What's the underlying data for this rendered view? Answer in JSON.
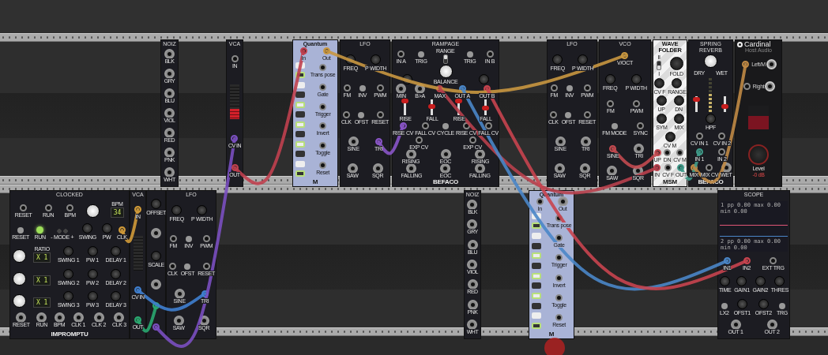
{
  "rows": [
    {
      "modules": [
        {
          "title": "NOIZ",
          "kind": "dark",
          "sections": [
            [
              {
                "kind": "out",
                "label": "BLK"
              }
            ],
            [
              {
                "kind": "out",
                "label": "GRY"
              }
            ],
            [
              {
                "kind": "out",
                "label": "BLU"
              }
            ],
            [
              {
                "kind": "out",
                "label": "VIOL"
              }
            ],
            [
              {
                "kind": "out",
                "label": "RED"
              }
            ],
            [
              {
                "kind": "out",
                "label": "PNK"
              }
            ],
            [
              {
                "kind": "out",
                "label": "WHT"
              }
            ]
          ]
        },
        {
          "title": "VCA",
          "kind": "dark",
          "sections": [
            [
              {
                "kind": "jack",
                "label": "IN"
              }
            ],
            [
              {
                "kind": "meter",
                "level": 0.3
              }
            ],
            [
              {
                "kind": "jack",
                "label": "CV IN",
                "color": "#7a4fc0"
              }
            ],
            [
              {
                "kind": "out",
                "label": "OUT",
                "color": "#c0404f"
              }
            ]
          ]
        },
        {
          "title": "Quantum",
          "kind": "quantum",
          "brand": "M",
          "keys": [
            {
              "on": false
            },
            {
              "on": true
            },
            {
              "on": false
            },
            {
              "on": false
            },
            {
              "on": true
            },
            {
              "on": false
            },
            {
              "on": true
            },
            {
              "on": false
            },
            {
              "on": true
            },
            {
              "on": false
            },
            {
              "on": false
            },
            {
              "on": true
            }
          ],
          "sections": [
            [
              {
                "kind": "jack",
                "label": "In",
                "color": "#c0404f"
              },
              {
                "kind": "out",
                "label": "Out",
                "color": "#c99740"
              }
            ],
            [
              {
                "kind": "jack",
                "label": "Trans pose"
              }
            ],
            [
              {
                "kind": "jack",
                "label": "Gate"
              }
            ],
            [
              {
                "kind": "jack",
                "label": "Trigger"
              }
            ],
            [
              {
                "kind": "jack",
                "label": "Invert"
              }
            ],
            [
              {
                "kind": "jack",
                "label": "Toggle"
              }
            ],
            [
              {
                "kind": "jack",
                "label": "Reset"
              }
            ]
          ]
        },
        {
          "title": "LFO",
          "kind": "dark",
          "sections": [
            [
              {
                "kind": "knob",
                "label": "FREQ"
              },
              {
                "kind": "knob",
                "label": "P WIDTH"
              }
            ],
            [
              {
                "kind": "jack",
                "label": "FM"
              },
              {
                "kind": "button",
                "label": "INV"
              },
              {
                "kind": "jack",
                "label": "PWM"
              }
            ],
            [
              {
                "kind": "jack",
                "label": "CLK"
              },
              {
                "kind": "button",
                "label": "OFST"
              },
              {
                "kind": "jack",
                "label": "RESET"
              }
            ],
            [
              {
                "kind": "out",
                "label": "SINE"
              },
              {
                "kind": "out",
                "label": "TRI",
                "color": "#8a55c8"
              }
            ],
            [
              {
                "kind": "out",
                "label": "SAW"
              },
              {
                "kind": "out",
                "label": "SQR"
              }
            ]
          ]
        },
        {
          "title": "RAMPAGE",
          "kind": "dark",
          "brand": "BEFACO",
          "sections": [
            [
              {
                "kind": "jack",
                "label": "IN A"
              },
              {
                "kind": "button",
                "label": "TRIG"
              },
              {
                "kind": "toggle",
                "label": "RANGE",
                "on": true
              },
              {
                "kind": "button",
                "label": "TRIG"
              },
              {
                "kind": "jack",
                "label": "IN B"
              }
            ],
            [
              {
                "kind": "knob"
              },
              {
                "kind": "bigknob",
                "label": "BALANCE"
              },
              {
                "kind": "knob"
              }
            ],
            [
              {
                "kind": "out",
                "label": "MIN"
              },
              {
                "kind": "out",
                "label": "B>A"
              },
              {
                "kind": "out",
                "label": "MAX",
                "color": "#b8404c"
              },
              {
                "kind": "out",
                "label": "OUT A",
                "color": "#4a86c8"
              },
              {
                "kind": "out",
                "label": "OUT B",
                "color": "#c8444f"
              }
            ],
            [
              {
                "kind": "slider",
                "label": "RISE",
                "level": 0.85
              },
              {
                "kind": "slider",
                "label": "FALL",
                "level": 0.45
              },
              {
                "kind": "slider",
                "label": "RISE",
                "level": 0.85
              },
              {
                "kind": "slider",
                "label": "FALL",
                "level": 0.3
              }
            ],
            [
              {
                "kind": "jack",
                "label": "RISE CV",
                "color": "#8a55c8"
              },
              {
                "kind": "jack",
                "label": "FALL CV"
              },
              {
                "kind": "button",
                "label": "CYCLE"
              },
              {
                "kind": "jack",
                "label": "RISE CV"
              },
              {
                "kind": "jack",
                "label": "FALL CV"
              }
            ],
            [
              {
                "kind": "jack",
                "label": "EXP CV"
              },
              {
                "kind": "jack",
                "label": "EXP CV"
              }
            ],
            [
              {
                "kind": "out",
                "label": "RISING"
              },
              {
                "kind": "out",
                "label": "EOC"
              },
              {
                "kind": "out",
                "label": "RISING"
              }
            ],
            [
              {
                "kind": "out",
                "label": "FALLING"
              },
              {
                "kind": "out",
                "label": "EOC"
              },
              {
                "kind": "out",
                "label": "FALLING"
              }
            ]
          ]
        },
        {
          "title": "LFO",
          "kind": "dark",
          "sections": [
            [
              {
                "kind": "knob",
                "label": "FREQ"
              },
              {
                "kind": "knob",
                "label": "P WIDTH"
              }
            ],
            [
              {
                "kind": "jack",
                "label": "FM"
              },
              {
                "kind": "button",
                "label": "INV"
              },
              {
                "kind": "jack",
                "label": "PWM"
              }
            ],
            [
              {
                "kind": "jack",
                "label": "CLK"
              },
              {
                "kind": "button",
                "label": "OFST"
              },
              {
                "kind": "jack",
                "label": "RESET"
              }
            ],
            [
              {
                "kind": "out",
                "label": "SINE"
              },
              {
                "kind": "out",
                "label": "TRI"
              }
            ],
            [
              {
                "kind": "out",
                "label": "SAW"
              },
              {
                "kind": "out",
                "label": "SQR"
              }
            ]
          ]
        },
        {
          "title": "VCO",
          "kind": "dark",
          "sections": [
            [
              {
                "kind": "jack",
                "label": "V/OCT",
                "color": "#c99740"
              }
            ],
            [
              {
                "kind": "knob",
                "label": "FREQ"
              },
              {
                "kind": "knob",
                "label": "P WIDTH"
              }
            ],
            [
              {
                "kind": "jack",
                "label": "FM"
              },
              {
                "kind": "jack",
                "label": "PWM"
              }
            ],
            [
              {
                "kind": "button",
                "label": "FM MODE"
              },
              {
                "kind": "jack",
                "label": "SYNC"
              }
            ],
            [
              {
                "kind": "out",
                "label": "SINE",
                "color": "#c24a50"
              },
              {
                "kind": "out",
                "label": "TRI"
              }
            ],
            [
              {
                "kind": "out",
                "label": "SAW"
              },
              {
                "kind": "out",
                "label": "SQR"
              }
            ]
          ]
        },
        {
          "title": "WAVE FOLDER",
          "kind": "folder",
          "brand": "MSM",
          "sections": [
            [
              {
                "kind": "toggle",
                "label": "II",
                "label2": "I",
                "on": false
              },
              {
                "kind": "bigknob",
                "label": "FOLD"
              }
            ],
            [
              {
                "kind": "knob",
                "label": "CV F"
              },
              {
                "kind": "knob",
                "label": "RANGE"
              }
            ],
            [
              {
                "kind": "knob",
                "label": "UP"
              },
              {
                "kind": "knob",
                "label": "DN"
              }
            ],
            [
              {
                "kind": "knob",
                "label": "SYM"
              },
              {
                "kind": "knob",
                "label": "MIX"
              }
            ],
            [
              {
                "kind": "knob",
                "label": "CV M"
              }
            ],
            [
              {
                "kind": "jack",
                "label": "UP",
                "color": "#c24a50"
              },
              {
                "kind": "jack",
                "label": "DN"
              },
              {
                "kind": "jack",
                "label": "CV M"
              }
            ],
            [
              {
                "kind": "jack",
                "label": "IN",
                "color": "#b8404c"
              },
              {
                "kind": "jack",
                "label": "CV F"
              },
              {
                "kind": "out",
                "label": "OUT",
                "color": "#3f9a8a"
              }
            ]
          ]
        },
        {
          "title": "SPRING REVERB",
          "kind": "dark",
          "brand": "BEFACO",
          "sections": [
            [
              {
                "kind": "bigknob"
              }
            ],
            [
              {
                "kind": "text",
                "label": "DRY"
              },
              {
                "kind": "text",
                "label": "WET"
              }
            ],
            [
              {
                "kind": "slider",
                "level": 0.75
              },
              {
                "kind": "vu"
              },
              {
                "kind": "slider",
                "level": 0.2
              }
            ],
            [
              {
                "kind": "knob",
                "label": "HPF"
              }
            ],
            [
              {
                "kind": "jack",
                "label": "CV IN 1"
              },
              {
                "kind": "jack",
                "label": "CV IN 2"
              }
            ],
            [
              {
                "kind": "jack",
                "label": "IN 1",
                "color": "#3f9a8a"
              },
              {
                "kind": "jack",
                "label": "IN 2"
              }
            ],
            [
              {
                "kind": "jack",
                "label": "MIX",
                "color": "#c08a45"
              },
              {
                "kind": "jack",
                "label": "MIX CV"
              },
              {
                "kind": "out",
                "label": "WET"
              }
            ]
          ]
        },
        {
          "title": "Cardinal",
          "subtitle": "Host Audio",
          "kind": "cardinal",
          "sections": [
            [
              {
                "kind": "jackpair",
                "label": "Left/M",
                "color": "#c08a45"
              }
            ],
            [
              {
                "kind": "jackpair",
                "label": "Right"
              }
            ],
            [
              {
                "kind": "meter",
                "level": 0.55
              }
            ],
            [
              {
                "kind": "bigknob",
                "label": "Level",
                "reading": "-0 dB"
              }
            ]
          ]
        }
      ]
    },
    {
      "modules": [
        {
          "title": "CLOCKED",
          "kind": "dark",
          "brand": "IMPROMPTU",
          "sections": [
            [
              {
                "kind": "jack",
                "label": "RESET"
              },
              {
                "kind": "jack",
                "label": "RUN"
              },
              {
                "kind": "jack",
                "label": "BPM"
              },
              {
                "kind": "bigknob"
              },
              {
                "kind": "display",
                "label": "BPM",
                "value": "34"
              }
            ],
            [
              {
                "kind": "button",
                "label": "RESET"
              },
              {
                "kind": "led",
                "label": "RUN",
                "on": true
              },
              {
                "kind": "buttons",
                "label": "- MODE +"
              },
              {
                "kind": "knob",
                "label": "SWING"
              },
              {
                "kind": "knob",
                "label": "PW"
              },
              {
                "kind": "jack",
                "label": "CLK",
                "color": "#d09a38"
              }
            ],
            [
              {
                "kind": "bigknob"
              },
              {
                "kind": "display",
                "label": "RATIO",
                "value": "X 1"
              },
              {
                "kind": "knob",
                "label": "SWING 1"
              },
              {
                "kind": "knob",
                "label": "PW 1"
              },
              {
                "kind": "knob",
                "label": "DELAY 1"
              }
            ],
            [
              {
                "kind": "bigknob"
              },
              {
                "kind": "display",
                "value": "X 1"
              },
              {
                "kind": "knob",
                "label": "SWING 2"
              },
              {
                "kind": "knob",
                "label": "PW 2"
              },
              {
                "kind": "knob",
                "label": "DELAY 2"
              }
            ],
            [
              {
                "kind": "bigknob"
              },
              {
                "kind": "display",
                "value": "X 1"
              },
              {
                "kind": "knob",
                "label": "SWING 3"
              },
              {
                "kind": "knob",
                "label": "PW 3"
              },
              {
                "kind": "knob",
                "label": "DELAY 3"
              }
            ],
            [
              {
                "kind": "out",
                "label": "RESET"
              },
              {
                "kind": "out",
                "label": "RUN"
              },
              {
                "kind": "out",
                "label": "BPM"
              },
              {
                "kind": "out",
                "label": "CLK 1"
              },
              {
                "kind": "out",
                "label": "CLK 2"
              },
              {
                "kind": "out",
                "label": "CLK 3"
              }
            ]
          ]
        },
        {
          "title": "VCA",
          "kind": "dark",
          "sections": [
            [
              {
                "kind": "jack",
                "label": "IN",
                "color": "#d09a38"
              }
            ],
            [
              {
                "kind": "meter",
                "level": 0
              }
            ],
            [
              {
                "kind": "jack",
                "label": "CV IN",
                "color": "#3f7fd0"
              }
            ],
            [
              {
                "kind": "out",
                "label": "OUT",
                "color": "#2aa870"
              }
            ]
          ]
        },
        {
          "kind": "dark",
          "sections": [
            [
              {
                "kind": "knob",
                "label": "OFFSET"
              }
            ],
            [
              {
                "kind": "out"
              }
            ],
            [
              {
                "kind": "knob",
                "label": "SCALE"
              }
            ],
            [
              {
                "kind": "out"
              }
            ],
            [
              {
                "kind": "out",
                "color": "#2aa870"
              }
            ],
            [
              {
                "kind": "out",
                "color": "#7a4fc0"
              }
            ]
          ]
        },
        {
          "title": "LFO",
          "kind": "dark",
          "sections": [
            [
              {
                "kind": "knob",
                "label": "FREQ"
              },
              {
                "kind": "knob",
                "label": "P WIDTH"
              }
            ],
            [
              {
                "kind": "jack",
                "label": "FM"
              },
              {
                "kind": "button",
                "label": "INV"
              },
              {
                "kind": "jack",
                "label": "PWM"
              }
            ],
            [
              {
                "kind": "jack",
                "label": "CLK"
              },
              {
                "kind": "button",
                "label": "OFST"
              },
              {
                "kind": "jack",
                "label": "RESET"
              }
            ],
            [
              {
                "kind": "out",
                "label": "SINE"
              },
              {
                "kind": "out",
                "label": "TRI",
                "color": "#3f7fd0"
              }
            ],
            [
              {
                "kind": "out",
                "label": "SAW"
              },
              {
                "kind": "out",
                "label": "SQR"
              }
            ]
          ]
        },
        {
          "title": "NOIZ",
          "kind": "dark",
          "sections": [
            [
              {
                "kind": "out",
                "label": "BLK"
              }
            ],
            [
              {
                "kind": "out",
                "label": "GRY"
              }
            ],
            [
              {
                "kind": "out",
                "label": "BLU"
              }
            ],
            [
              {
                "kind": "out",
                "label": "VIOL"
              }
            ],
            [
              {
                "kind": "out",
                "label": "RED"
              }
            ],
            [
              {
                "kind": "out",
                "label": "PNK"
              }
            ],
            [
              {
                "kind": "out",
                "label": "WHT"
              }
            ]
          ]
        },
        {
          "title": "Quantum",
          "kind": "quantum",
          "brand": "M",
          "keys": [
            {
              "on": false
            },
            {
              "on": true
            },
            {
              "on": false
            },
            {
              "on": false
            },
            {
              "on": true
            },
            {
              "on": false
            },
            {
              "on": true
            },
            {
              "on": false
            },
            {
              "on": true
            },
            {
              "on": false
            },
            {
              "on": false
            },
            {
              "on": true
            }
          ],
          "sections": [
            [
              {
                "kind": "jack",
                "label": "In"
              },
              {
                "kind": "out",
                "label": "Out"
              }
            ],
            [
              {
                "kind": "jack",
                "label": "Trans pose"
              }
            ],
            [
              {
                "kind": "jack",
                "label": "Gate"
              }
            ],
            [
              {
                "kind": "jack",
                "label": "Trigger"
              }
            ],
            [
              {
                "kind": "jack",
                "label": "Invert"
              }
            ],
            [
              {
                "kind": "jack",
                "label": "Toggle"
              }
            ],
            [
              {
                "kind": "jack",
                "label": "Reset"
              }
            ]
          ]
        },
        {
          "title": "SCOPE",
          "kind": "dark",
          "sections": [
            [
              {
                "kind": "scope",
                "lines": [
                  "1 pp 0.00 max 0.00 min 0.00",
                  "2 pp 0.00 max 0.00 min 0.00"
                ]
              }
            ],
            [
              {
                "kind": "jack",
                "label": "IN1",
                "color": "#4a86c8"
              },
              {
                "kind": "jack",
                "label": "IN2",
                "color": "#c8444f"
              },
              {
                "kind": "jack",
                "label": "EXT TRG"
              }
            ],
            [
              {
                "kind": "knob",
                "label": "TIME"
              },
              {
                "kind": "knob",
                "label": "GAIN1"
              },
              {
                "kind": "knob",
                "label": "GAIN2"
              },
              {
                "kind": "knob",
                "label": "THRES"
              }
            ],
            [
              {
                "kind": "button",
                "label": "LX2"
              },
              {
                "kind": "knob",
                "label": "OFST1"
              },
              {
                "kind": "knob",
                "label": "OFST2"
              },
              {
                "kind": "button",
                "label": "TRG"
              }
            ],
            [
              {
                "kind": "out",
                "label": "OUT 1"
              },
              {
                "kind": "out",
                "label": "OUT 2"
              }
            ]
          ]
        }
      ]
    }
  ],
  "pointer": {
    "visible": true
  }
}
